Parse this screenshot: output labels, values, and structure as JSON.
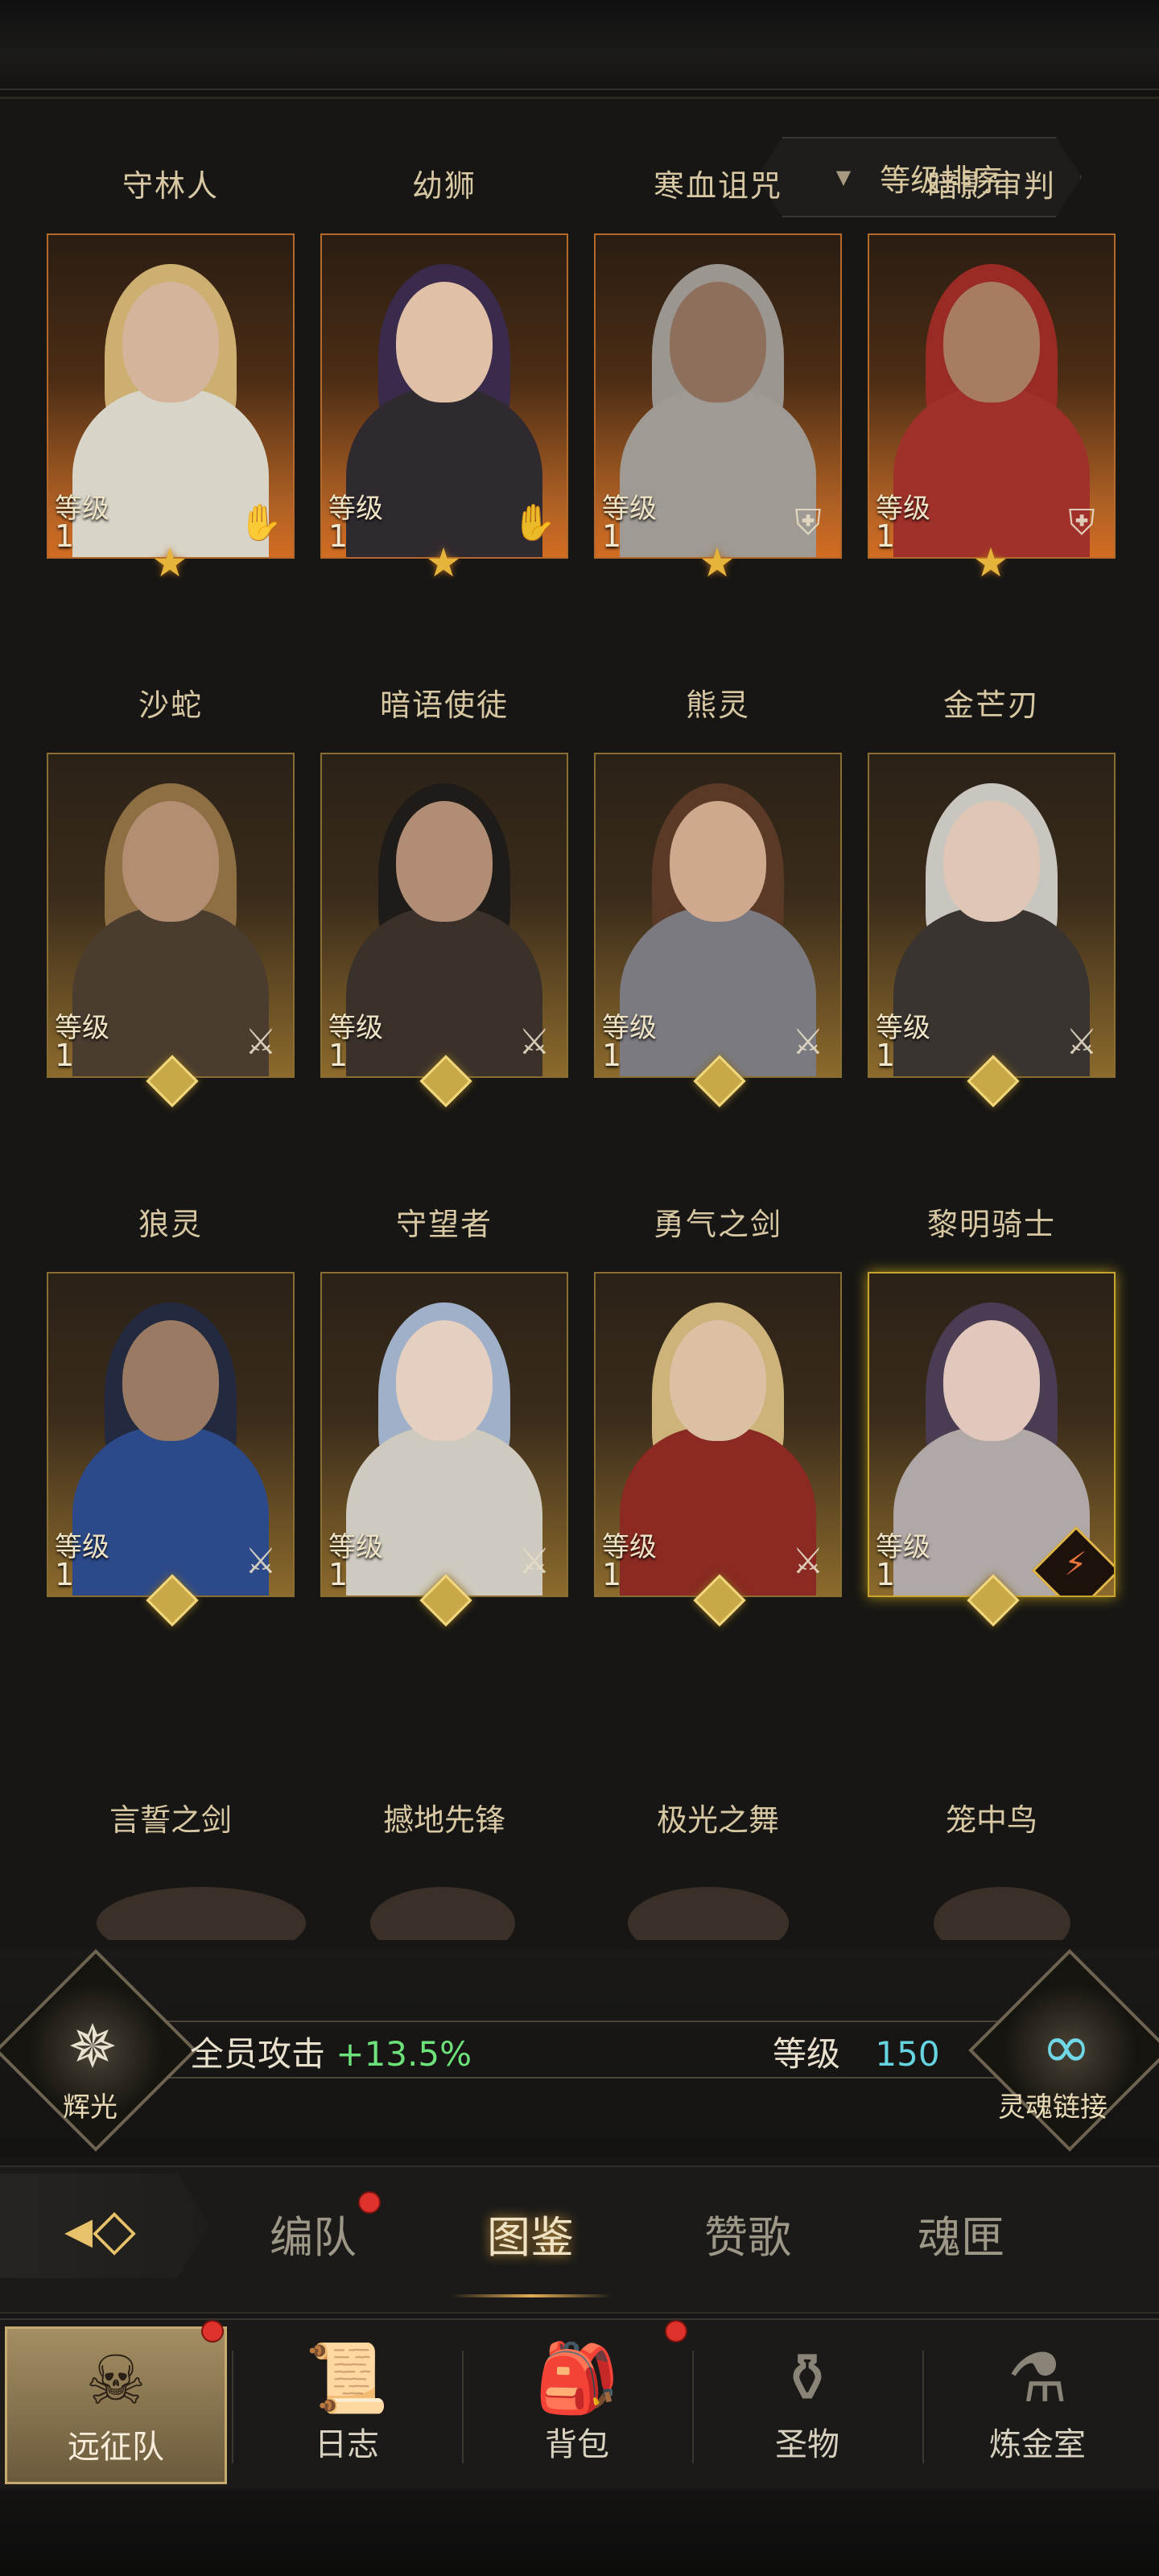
{
  "sort": {
    "label": "等级排序",
    "icon": "triangle-down-icon"
  },
  "level_label": "等级",
  "heroes": [
    {
      "name": "守林人",
      "level": "1",
      "class_icon": "hand-icon",
      "badge": "star",
      "tone": "orange",
      "hair": "#cdb071",
      "skin": "#d4b49b",
      "cloth": "#d8d4c8"
    },
    {
      "name": "幼狮",
      "level": "1",
      "class_icon": "hand-icon",
      "badge": "star",
      "tone": "orange",
      "hair": "#3a2a4c",
      "skin": "#e0c0a6",
      "cloth": "#2f2a30"
    },
    {
      "name": "寒血诅咒",
      "level": "1",
      "class_icon": "shield-icon",
      "badge": "star",
      "tone": "orange",
      "hair": "#9b9690",
      "skin": "#8d6f5c",
      "cloth": "#9f9a93"
    },
    {
      "name": "暗影审判",
      "level": "1",
      "class_icon": "shield-icon",
      "badge": "star",
      "tone": "orange",
      "hair": "#9a2b24",
      "skin": "#a77c60",
      "cloth": "#a0302a"
    },
    {
      "name": "沙蛇",
      "level": "1",
      "class_icon": "sword-icon",
      "badge": "diamond",
      "tone": "gold",
      "hair": "#8e6f44",
      "skin": "#b48e72",
      "cloth": "#4a3c2e"
    },
    {
      "name": "暗语使徒",
      "level": "1",
      "class_icon": "sword-icon",
      "badge": "diamond",
      "tone": "gold",
      "hair": "#1f1b18",
      "skin": "#b08d74",
      "cloth": "#3a312a"
    },
    {
      "name": "熊灵",
      "level": "1",
      "class_icon": "sword-icon",
      "badge": "diamond",
      "tone": "gold",
      "hair": "#5a3a26",
      "skin": "#cfa98d",
      "cloth": "#7a7a80"
    },
    {
      "name": "金芒刃",
      "level": "1",
      "class_icon": "sword-icon",
      "badge": "diamond",
      "tone": "gold",
      "hair": "#c9c6c0",
      "skin": "#e0c6b4",
      "cloth": "#3a3430"
    },
    {
      "name": "狼灵",
      "level": "1",
      "class_icon": "sword-icon",
      "badge": "diamond",
      "tone": "gold",
      "hair": "#232a40",
      "skin": "#9a7a62",
      "cloth": "#2c4a8a"
    },
    {
      "name": "守望者",
      "level": "1",
      "class_icon": "sword-icon",
      "badge": "diamond",
      "tone": "gold",
      "hair": "#9fb0c8",
      "skin": "#e4cfc0",
      "cloth": "#cfcabf"
    },
    {
      "name": "勇气之剑",
      "level": "1",
      "class_icon": "sword-icon",
      "badge": "diamond",
      "tone": "gold",
      "hair": "#cdb27a",
      "skin": "#dcc0a4",
      "cloth": "#8a2a22"
    },
    {
      "name": "黎明骑士",
      "level": "1",
      "class_icon": "special-icon",
      "badge": "diamond",
      "tone": "gold-yellow",
      "hair": "#4a3c52",
      "skin": "#e2c8bc",
      "cloth": "#b0a8a6"
    }
  ],
  "next_row_names": [
    "言誓之剑",
    "撼地先锋",
    "极光之舞",
    "笼中鸟"
  ],
  "stats": {
    "left_emblem_icon": "compass-icon",
    "left_caption": "辉光",
    "attack_label": "全员攻击",
    "attack_value": "+13.5%",
    "level_label": "等级",
    "level_value": "150",
    "right_emblem_icon": "chain-link-icon",
    "right_caption": "灵魂链接"
  },
  "tabs": [
    {
      "label": "编队",
      "dot": true
    },
    {
      "label": "图鉴",
      "active": true
    },
    {
      "label": "赞歌"
    },
    {
      "label": "魂匣"
    }
  ],
  "nav": [
    {
      "label": "远征队",
      "icon": "horned-helmet-icon",
      "active": true,
      "dot": true
    },
    {
      "label": "日志",
      "icon": "scroll-icon"
    },
    {
      "label": "背包",
      "icon": "backpack-icon",
      "dot": true
    },
    {
      "label": "圣物",
      "icon": "relic-icon"
    },
    {
      "label": "炼金室",
      "icon": "alchemy-icon"
    }
  ]
}
